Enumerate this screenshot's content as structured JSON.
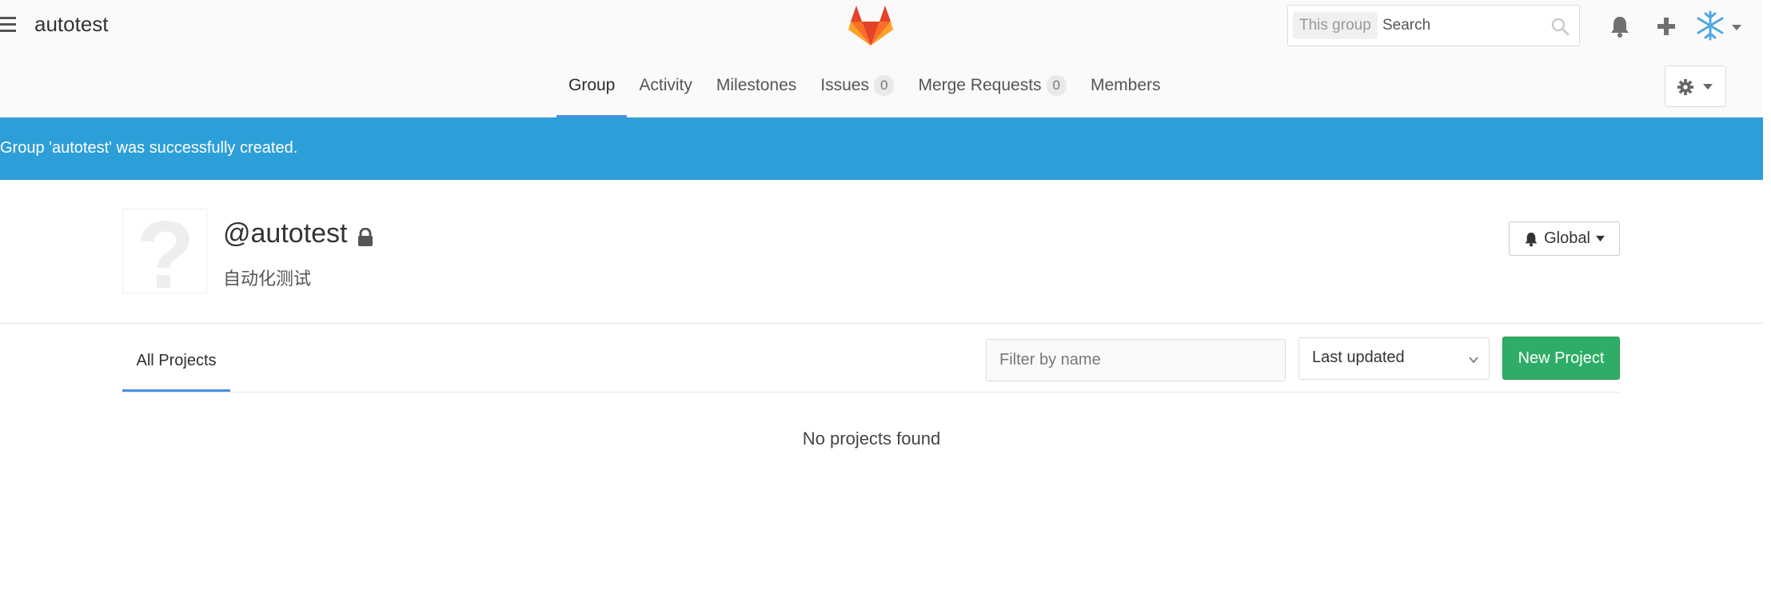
{
  "header": {
    "group_name": "autotest",
    "search_scope": "This group",
    "search_placeholder": "Search",
    "nav": [
      {
        "label": "Group",
        "active": true
      },
      {
        "label": "Activity"
      },
      {
        "label": "Milestones"
      },
      {
        "label": "Issues",
        "badge": "0"
      },
      {
        "label": "Merge Requests",
        "badge": "0"
      },
      {
        "label": "Members"
      }
    ]
  },
  "flash": {
    "message": "Group 'autotest' was successfully created."
  },
  "group": {
    "path": "@autotest",
    "description": "自动化测试",
    "notification_label": "Global"
  },
  "projects": {
    "tab_label": "All Projects",
    "filter_placeholder": "Filter by name",
    "sort_label": "Last updated",
    "new_project_label": "New Project",
    "empty_message": "No projects found"
  },
  "colors": {
    "flash_bg": "#2d9fd8",
    "accent": "#4a90e2",
    "success": "#2fad68"
  },
  "icons": [
    "menu-icon",
    "gitlab-logo",
    "search-icon",
    "bell-icon",
    "plus-icon",
    "avatar",
    "caret-down-icon",
    "gear-icon",
    "lock-icon",
    "question-mark-icon",
    "chevron-down-icon"
  ]
}
